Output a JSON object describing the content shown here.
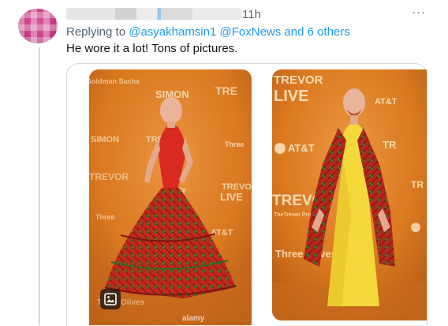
{
  "tweet": {
    "time": "11h",
    "replying_prefix": "Replying to ",
    "mention_1": "@asyakhamsin1",
    "mention_2": "@FoxNews",
    "and_text": " and ",
    "others_text": "6 others",
    "text": "He wore it a lot!  Tons of pictures."
  },
  "icons": {
    "more": "more-dots-icon",
    "gallery": "image-gallery-icon"
  },
  "colors": {
    "link": "#1d9bf0",
    "secondary_text": "#536471",
    "primary_text": "#0f1419",
    "backdrop_orange": "#d9781f",
    "dress_red": "#c92a1f",
    "dress_yellow": "#f4d83a"
  },
  "photo_watermarks": {
    "photo_1": [
      "SIMON",
      "TREVOR",
      "LIVE",
      "AT&T",
      "alamy",
      "Three Olives"
    ],
    "photo_2": [
      "TREVOR",
      "LIVE",
      "AT&T",
      "TREVOR",
      "Three Olives"
    ]
  }
}
